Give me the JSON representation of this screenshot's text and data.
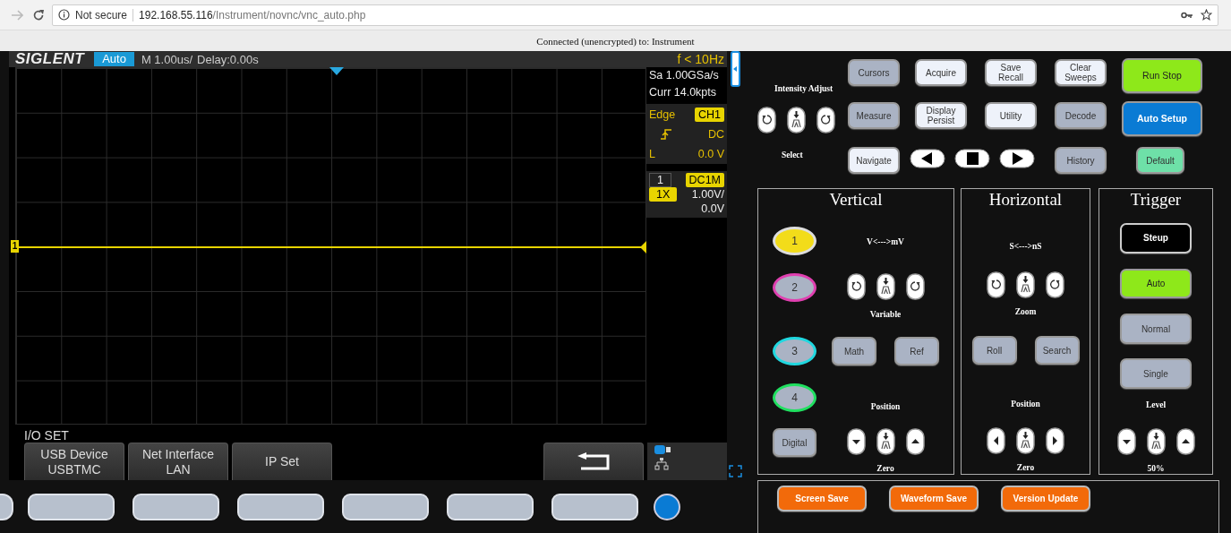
{
  "browser": {
    "security_label": "Not secure",
    "url_host": "192.168.55.116",
    "url_path": "/Instrument/novnc/vnc_auto.php"
  },
  "connection_status": "Connected (unencrypted) to: Instrument",
  "scope": {
    "brand": "SIGLENT",
    "acquire_mode": "Auto",
    "timebase": "M 1.00us/",
    "delay": "Delay:0.00s",
    "frequency": "f < 10Hz",
    "sample_rate": "Sa 1.00GSa/s",
    "memory_depth": "Curr 14.0kpts",
    "trigger": {
      "type": "Edge",
      "source": "CH1",
      "coupling": "DC",
      "level_label": "L",
      "level_value": "0.0 V"
    },
    "channel": {
      "number": "1",
      "coupling": "DC1M",
      "probe": "1X",
      "scale": "1.00V/",
      "offset": "0.0V"
    },
    "trace_label": "1",
    "menu_title": "I/O SET",
    "softkeys": [
      {
        "lines": [
          "USB Device",
          "USBTMC"
        ]
      },
      {
        "lines": [
          "Net Interface",
          "LAN"
        ]
      },
      {
        "lines": [
          "IP Set"
        ]
      }
    ]
  },
  "panel": {
    "intensity_label": "Intensity Adjust",
    "select_label": "Select",
    "buttons": [
      {
        "label": "Cursors",
        "kind": "grey"
      },
      {
        "label": "Acquire",
        "kind": "light"
      },
      {
        "label": "Save\nRecall",
        "kind": "light"
      },
      {
        "label": "Clear\nSweeps",
        "kind": "light"
      },
      {
        "label": "Run Stop",
        "kind": "green"
      },
      {
        "label": "Measure",
        "kind": "grey"
      },
      {
        "label": "Display\nPersist",
        "kind": "light"
      },
      {
        "label": "Utility",
        "kind": "light"
      },
      {
        "label": "Decode",
        "kind": "grey"
      },
      {
        "label": "Auto Setup",
        "kind": "blue"
      },
      {
        "label": "Navigate",
        "kind": "light"
      },
      {
        "label": "History",
        "kind": "grey"
      },
      {
        "label": "Default",
        "kind": "mint"
      }
    ],
    "vertical": {
      "title": "Vertical",
      "channels": [
        {
          "label": "1",
          "color": "#f2dc1a",
          "on": true
        },
        {
          "label": "2",
          "color": "#e040b0",
          "on": false
        },
        {
          "label": "3",
          "color": "#20d8e0",
          "on": false
        },
        {
          "label": "4",
          "color": "#20e060",
          "on": false
        }
      ],
      "digital": "Digital",
      "scale_label": "V<--->mV",
      "variable_label": "Variable",
      "math": "Math",
      "ref": "Ref",
      "position_label": "Position",
      "zero_label": "Zero"
    },
    "horizontal": {
      "title": "Horizontal",
      "scale_label": "S<--->nS",
      "zoom_label": "Zoom",
      "roll": "Roll",
      "search": "Search",
      "position_label": "Position",
      "zero_label": "Zero"
    },
    "trigger": {
      "title": "Trigger",
      "modes": [
        {
          "label": "Steup",
          "kind": "dark"
        },
        {
          "label": "Auto",
          "kind": "green"
        },
        {
          "label": "Normal",
          "kind": "grey"
        },
        {
          "label": "Single",
          "kind": "grey"
        }
      ],
      "level_label": "Level",
      "level_value": "50%"
    },
    "bottom_buttons": [
      "Screen Save",
      "Waveform Save",
      "Version Update"
    ]
  }
}
